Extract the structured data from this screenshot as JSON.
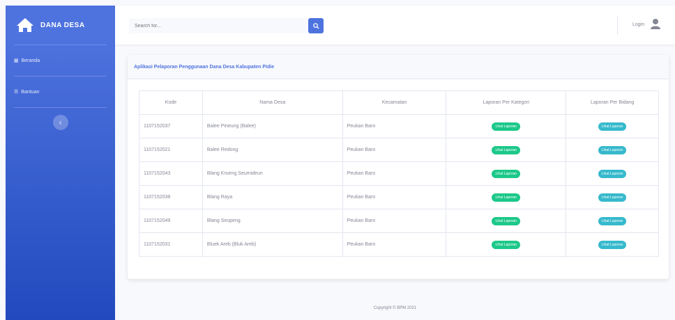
{
  "sidebar": {
    "brand": "DANA DESA",
    "items": [
      {
        "label": "Beranda"
      },
      {
        "label": "Bantuan"
      }
    ]
  },
  "topbar": {
    "search_placeholder": "Search for...",
    "user": "Login"
  },
  "card": {
    "title": "Aplikasi Pelaporan Penggunaan Dana Desa Kabupaten Pidie"
  },
  "table": {
    "headers": [
      "Kode",
      "Nama Desa",
      "Kecamatan",
      "Laporan Per Kategori",
      "Laporan Per Bidang"
    ],
    "rows": [
      {
        "kode": "1107152037",
        "desa": "Balee Pineung (Balee)",
        "kec": "Peukan Baro",
        "k_btn": "Lihat Laporan",
        "b_btn": "Lihat Laporan"
      },
      {
        "kode": "1107152021",
        "desa": "Balee Redong",
        "kec": "Peukan Baro",
        "k_btn": "Lihat Laporan",
        "b_btn": "Lihat Laporan"
      },
      {
        "kode": "1107152043",
        "desa": "Blang Krueng Seumideun",
        "kec": "Peukan Baro",
        "k_btn": "Lihat Laporan",
        "b_btn": "Lihat Laporan"
      },
      {
        "kode": "1107152038",
        "desa": "Blang Raya",
        "kec": "Peukan Baro",
        "k_btn": "Lihat Laporan",
        "b_btn": "Lihat Laporan"
      },
      {
        "kode": "1107152049",
        "desa": "Blang Seupeng",
        "kec": "Peukan Baro",
        "k_btn": "Lihat Laporan",
        "b_btn": "Lihat Laporan"
      },
      {
        "kode": "1107152031",
        "desa": "Bluek Areb (Bluk Areb)",
        "kec": "Peukan Baro",
        "k_btn": "Lihat Laporan",
        "b_btn": "Lihat Laporan"
      }
    ]
  },
  "footer": {
    "text": "Copyright © BPM 2021"
  },
  "colors": {
    "primary": "#4e73df",
    "success": "#1cc88a",
    "info": "#36b9cc"
  }
}
